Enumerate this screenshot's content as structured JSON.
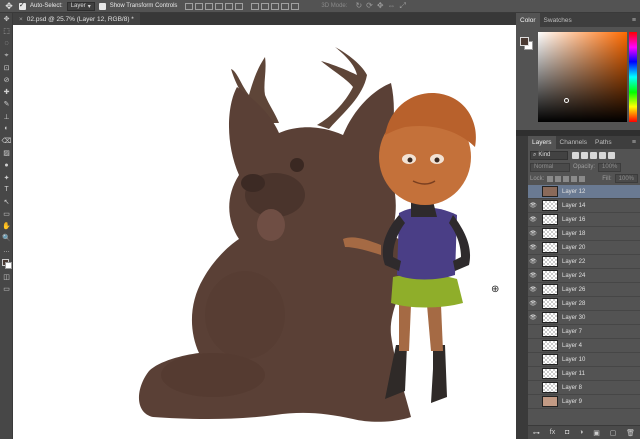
{
  "options_bar": {
    "move_tool_icon": "✥",
    "auto_select_label": "Auto-Select:",
    "auto_select_checked": true,
    "auto_select_target": "Layer",
    "show_transform_label": "Show Transform Controls",
    "mode_3d_label": "3D Mode:"
  },
  "document": {
    "tab_title": "02.psd @ 25.7% (Layer 12, RGB/8) *",
    "close_glyph": "×"
  },
  "tools": [
    "✥",
    "⬚",
    "◌",
    "⌖",
    "⊡",
    "⊘",
    "✚",
    "✎",
    "⊥",
    "◐",
    "⌫",
    "▨",
    "●",
    "✦",
    "T",
    "↖",
    "▭",
    "✋",
    "🔍",
    "…"
  ],
  "color_panel": {
    "tabs": [
      "Color",
      "Swatches"
    ],
    "active_tab": "Color",
    "menu_glyph": "≡",
    "foreground": "#4a3a33",
    "background": "#ffffff"
  },
  "layers_panel": {
    "tabs": [
      "Layers",
      "Channels",
      "Paths"
    ],
    "active_tab": "Layers",
    "menu_glyph": "≡",
    "kind_label": "Kind",
    "blend_mode": "Normal",
    "opacity_label": "Opacity:",
    "opacity_value": "100%",
    "lock_label": "Lock:",
    "fill_label": "Fill:",
    "fill_value": "100%",
    "layers": [
      {
        "name": "Layer 12",
        "visible": false,
        "thumb": "photo",
        "selected": true
      },
      {
        "name": "Layer 14",
        "visible": true,
        "thumb": "trans",
        "selected": false
      },
      {
        "name": "Layer 16",
        "visible": true,
        "thumb": "trans",
        "selected": false
      },
      {
        "name": "Layer 18",
        "visible": true,
        "thumb": "trans",
        "selected": false
      },
      {
        "name": "Layer 20",
        "visible": true,
        "thumb": "trans",
        "selected": false
      },
      {
        "name": "Layer 22",
        "visible": true,
        "thumb": "trans",
        "selected": false
      },
      {
        "name": "Layer 24",
        "visible": true,
        "thumb": "trans",
        "selected": false
      },
      {
        "name": "Layer 26",
        "visible": true,
        "thumb": "trans",
        "selected": false
      },
      {
        "name": "Layer 28",
        "visible": true,
        "thumb": "trans",
        "selected": false
      },
      {
        "name": "Layer 30",
        "visible": true,
        "thumb": "trans",
        "selected": false
      },
      {
        "name": "Layer 7",
        "visible": false,
        "thumb": "trans",
        "selected": false
      },
      {
        "name": "Layer 4",
        "visible": false,
        "thumb": "trans",
        "selected": false
      },
      {
        "name": "Layer 10",
        "visible": false,
        "thumb": "trans",
        "selected": false
      },
      {
        "name": "Layer 11",
        "visible": false,
        "thumb": "trans",
        "selected": false
      },
      {
        "name": "Layer 8",
        "visible": false,
        "thumb": "trans",
        "selected": false
      },
      {
        "name": "Layer 9",
        "visible": false,
        "thumb": "tan",
        "selected": false
      }
    ],
    "footer_icons": [
      "⊶",
      "fx",
      "◘",
      "◑",
      "▣",
      "▢",
      "🗑"
    ]
  },
  "icons": {
    "eye": "👁",
    "zoom_cursor": "⊕",
    "kind_search": "⌕"
  }
}
